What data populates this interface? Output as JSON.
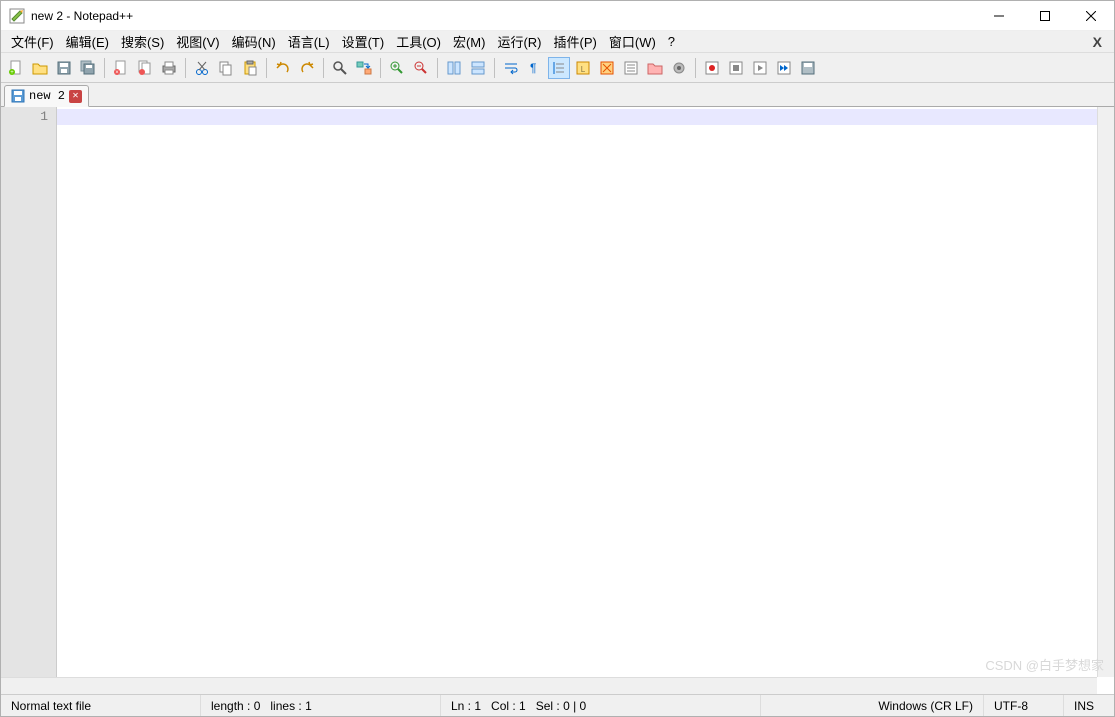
{
  "window": {
    "title": "new 2 - Notepad++"
  },
  "menu": {
    "items": [
      "文件(F)",
      "编辑(E)",
      "搜索(S)",
      "视图(V)",
      "编码(N)",
      "语言(L)",
      "设置(T)",
      "工具(O)",
      "宏(M)",
      "运行(R)",
      "插件(P)",
      "窗口(W)",
      "?"
    ],
    "close_x": "X"
  },
  "tabs": [
    {
      "label": "new 2",
      "modified": false
    }
  ],
  "editor": {
    "line_numbers": [
      "1"
    ]
  },
  "status": {
    "filetype": "Normal text file",
    "length_label": "length : 0",
    "lines_label": "lines : 1",
    "ln": "Ln : 1",
    "col": "Col : 1",
    "sel": "Sel : 0 | 0",
    "eol": "Windows (CR LF)",
    "encoding": "UTF-8",
    "mode": "INS"
  },
  "watermark": "CSDN @白手梦想家"
}
